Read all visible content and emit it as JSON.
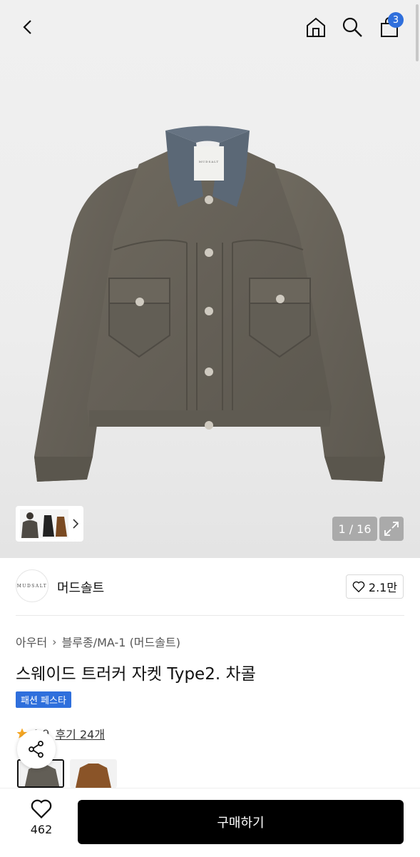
{
  "header": {
    "back_icon": "chevron-left-icon",
    "home_icon": "home-icon",
    "search_icon": "search-icon",
    "cart_icon": "shopping-bag-icon",
    "cart_count": "3"
  },
  "gallery": {
    "counter": "1 / 16",
    "expand_icon": "expand-icon",
    "thumb_arrow_icon": "chevron-right-icon"
  },
  "brand": {
    "logo_text": "MUDSALT",
    "name": "머드솔트",
    "like_count": "2.1만"
  },
  "product": {
    "breadcrumbs": [
      "아우터",
      "블루종/MA-1 (머드솔트)"
    ],
    "title": "스웨이드 트러커 자켓 Type2. 차콜",
    "tag": "패션 페스타",
    "rating": "4.9",
    "review_link": "후기 24개"
  },
  "bottom": {
    "wish_count": "462",
    "buy_label": "구매하기"
  },
  "colors": {
    "accent": "#2f6fdc",
    "buy_button": "#000000"
  }
}
